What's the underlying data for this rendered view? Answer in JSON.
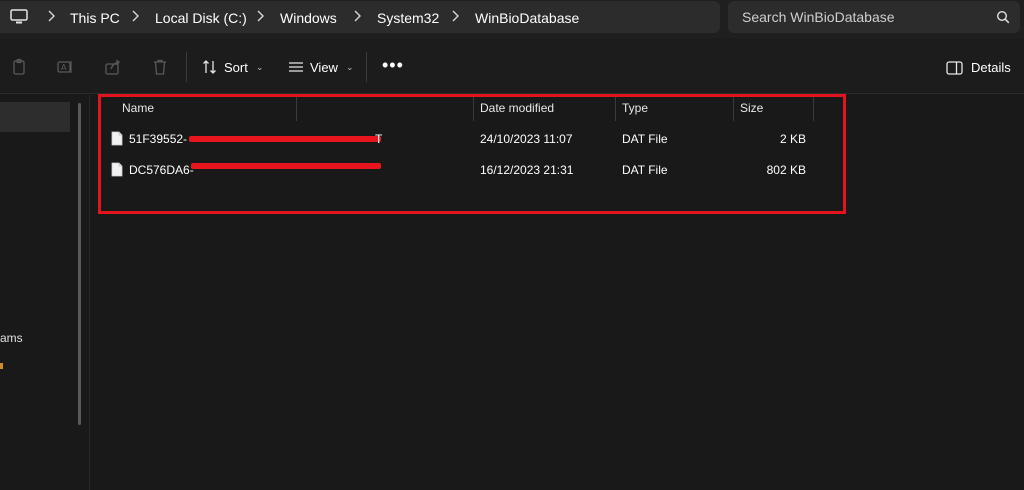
{
  "address_bar": {
    "crumbs": [
      "This PC",
      "Local Disk (C:)",
      "Windows",
      "System32",
      "WinBioDatabase"
    ],
    "search_placeholder": "Search WinBioDatabase"
  },
  "toolbar": {
    "sort_label": "Sort",
    "view_label": "View",
    "more_label": "•••",
    "details_label": "Details"
  },
  "nav": {
    "fragment_text": "ams"
  },
  "columns": {
    "name": "Name",
    "date_modified": "Date modified",
    "type": "Type",
    "size": "Size"
  },
  "files": [
    {
      "name_visible_start": "51F39552-",
      "name_visible_end": "T",
      "date_modified": "24/10/2023 11:07",
      "type": "DAT File",
      "size": "2 KB"
    },
    {
      "name_visible_start": "DC576DA6-",
      "name_visible_end": "",
      "date_modified": "16/12/2023 21:31",
      "type": "DAT File",
      "size": "802 KB"
    }
  ],
  "colors": {
    "background": "#191919",
    "panel": "#2c2c2c",
    "highlight_border": "#e3141d",
    "redaction": "#e8151f"
  },
  "icons": [
    "pc-icon",
    "chevron-right-icon",
    "search-icon",
    "copy-icon",
    "rename-icon",
    "share-icon",
    "delete-icon",
    "sort-icon",
    "view-icon",
    "details-pane-icon",
    "file-icon"
  ]
}
